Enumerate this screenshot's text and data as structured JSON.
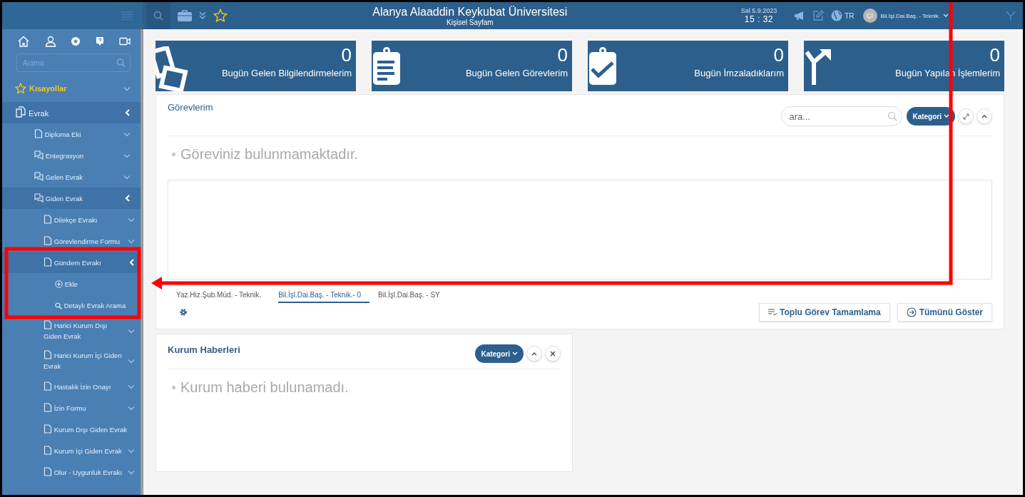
{
  "header": {
    "title": "Alanya Alaaddin Keykubat Üniversitesi",
    "subtitle": "Kişisel Sayfam",
    "date": "Sal 5.9.2023",
    "time": "15 : 32",
    "language": "TR",
    "avatar_initials": "Çİ",
    "user": "Bil.İşl.Dai.Baş. - Teknik."
  },
  "sidebar": {
    "search": {
      "placeholder": "Arama"
    },
    "shortcuts": {
      "label": "Kısayollar",
      "expanded": false
    },
    "items": [
      {
        "label": "Evrak",
        "kind": "files",
        "expanded": true,
        "children": [
          {
            "label": "Diploma Eki",
            "kind": "file",
            "expanded": false
          },
          {
            "label": "Entegrasyon",
            "kind": "chat",
            "expanded": false
          },
          {
            "label": "Gelen Evrak",
            "kind": "chat",
            "expanded": false
          },
          {
            "label": "Giden Evrak",
            "kind": "chat",
            "expanded": true,
            "children": [
              {
                "label": "Dilekçe Evrakı",
                "kind": "file",
                "expanded": false
              },
              {
                "label": "Görevlendirme Formu",
                "kind": "file",
                "expanded": false
              },
              {
                "label": "Gündem Evrakı",
                "kind": "file",
                "expanded": true,
                "children": [
                  {
                    "label": "Ekle",
                    "kind": "add"
                  },
                  {
                    "label": "Detaylı Evrak Arama",
                    "kind": "search"
                  }
                ]
              },
              {
                "label": "Harici Kurum Dışı Giden Evrak",
                "kind": "file",
                "expanded": false
              },
              {
                "label": "Harici Kurum İçi Giden Evrak",
                "kind": "file",
                "expanded": false
              },
              {
                "label": "Hastalık İzin Onayı",
                "kind": "file",
                "expanded": false
              },
              {
                "label": "İzin Formu",
                "kind": "file",
                "expanded": false
              },
              {
                "label": "Kurum Dışı Giden Evrak",
                "kind": "file"
              },
              {
                "label": "Kurum İçi Giden Evrak",
                "kind": "file",
                "expanded": false
              },
              {
                "label": "Olur - Uygunluk Evrakı",
                "kind": "file",
                "expanded": false
              }
            ]
          }
        ]
      }
    ]
  },
  "stats": [
    {
      "kind": "papers",
      "count": "0",
      "label": "Bugün Gelen Bilgilendirmelerim"
    },
    {
      "kind": "clipboard",
      "count": "0",
      "label": "Bugün Gelen Görevlerim"
    },
    {
      "kind": "signed",
      "count": "0",
      "label": "Bugün İmzaladıklarım"
    },
    {
      "kind": "fork",
      "count": "0",
      "label": "Bugün Yapılan İşlemlerim"
    }
  ],
  "tasks_panel": {
    "title": "Görevlerim",
    "search": {
      "placeholder": "ara..."
    },
    "category_button": "Kategori",
    "empty_message": "Göreviniz bulunmamaktadır.",
    "tabs": [
      {
        "label": "Yaz.Hiz.Şub.Müd. - Teknik.",
        "selected": false
      },
      {
        "label": "Bil.İşl.Dai.Baş. - Teknik.- 0",
        "selected": true
      },
      {
        "label": "Bil.İşl.Dai.Baş. - SY",
        "selected": false
      }
    ],
    "buttons": [
      {
        "kind": "bulk",
        "label": "Toplu Görev Tamamlama"
      },
      {
        "kind": "show-all",
        "label": "Tümünü Göster"
      }
    ]
  },
  "news_panel": {
    "title": "Kurum Haberleri",
    "category_button": "Kategori",
    "empty_message": "Kurum haberi bulunamadı."
  }
}
